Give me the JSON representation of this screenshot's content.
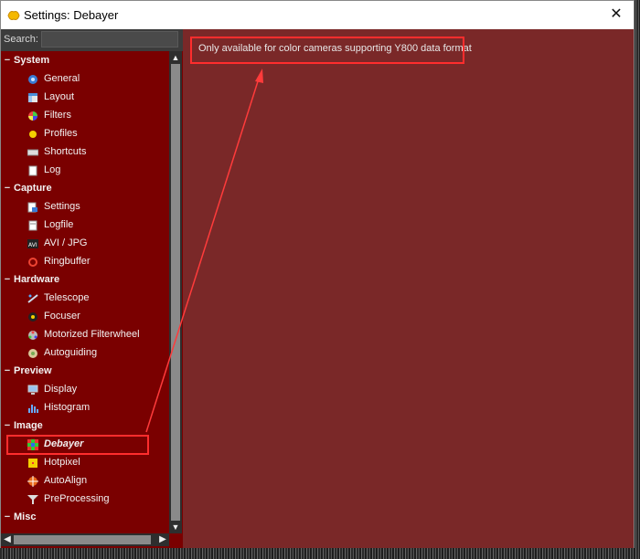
{
  "window": {
    "title": "Settings: Debayer",
    "close_glyph": "✕"
  },
  "search": {
    "label": "Search:",
    "value": "",
    "placeholder": ""
  },
  "tree": [
    {
      "type": "category",
      "label": "System",
      "toggle": "−"
    },
    {
      "type": "item",
      "label": "General",
      "icon": "gear-icon"
    },
    {
      "type": "item",
      "label": "Layout",
      "icon": "layout-icon"
    },
    {
      "type": "item",
      "label": "Filters",
      "icon": "color-wheel-icon"
    },
    {
      "type": "item",
      "label": "Profiles",
      "icon": "profile-icon"
    },
    {
      "type": "item",
      "label": "Shortcuts",
      "icon": "keyboard-icon"
    },
    {
      "type": "item",
      "label": "Log",
      "icon": "log-icon"
    },
    {
      "type": "category",
      "label": "Capture",
      "toggle": "−"
    },
    {
      "type": "item",
      "label": "Settings",
      "icon": "capture-settings-icon"
    },
    {
      "type": "item",
      "label": "Logfile",
      "icon": "file-icon"
    },
    {
      "type": "item",
      "label": "AVI / JPG",
      "icon": "avi-icon"
    },
    {
      "type": "item",
      "label": "Ringbuffer",
      "icon": "ring-icon"
    },
    {
      "type": "category",
      "label": "Hardware",
      "toggle": "−"
    },
    {
      "type": "item",
      "label": "Telescope",
      "icon": "telescope-icon"
    },
    {
      "type": "item",
      "label": "Focuser",
      "icon": "focuser-icon"
    },
    {
      "type": "item",
      "label": "Motorized Filterwheel",
      "icon": "filterwheel-icon"
    },
    {
      "type": "item",
      "label": "Autoguiding",
      "icon": "autoguiding-icon"
    },
    {
      "type": "category",
      "label": "Preview",
      "toggle": "−"
    },
    {
      "type": "item",
      "label": "Display",
      "icon": "monitor-icon"
    },
    {
      "type": "item",
      "label": "Histogram",
      "icon": "histogram-icon"
    },
    {
      "type": "category",
      "label": "Image",
      "toggle": "−"
    },
    {
      "type": "item",
      "label": "Debayer",
      "icon": "debayer-grid-icon",
      "selected": true
    },
    {
      "type": "item",
      "label": "Hotpixel",
      "icon": "hotpixel-icon"
    },
    {
      "type": "item",
      "label": "AutoAlign",
      "icon": "autoalign-icon"
    },
    {
      "type": "item",
      "label": "PreProcessing",
      "icon": "funnel-icon"
    },
    {
      "type": "category",
      "label": "Misc",
      "toggle": "−"
    }
  ],
  "content": {
    "info_text": "Only available for color cameras supporting Y800 data format"
  },
  "scrollbars": {
    "up": "▲",
    "down": "▼",
    "left": "◀",
    "right": "▶"
  },
  "colors": {
    "sidebar_bg": "#7a0000",
    "content_bg": "#7a2828",
    "annotation": "#ff2d2d"
  }
}
